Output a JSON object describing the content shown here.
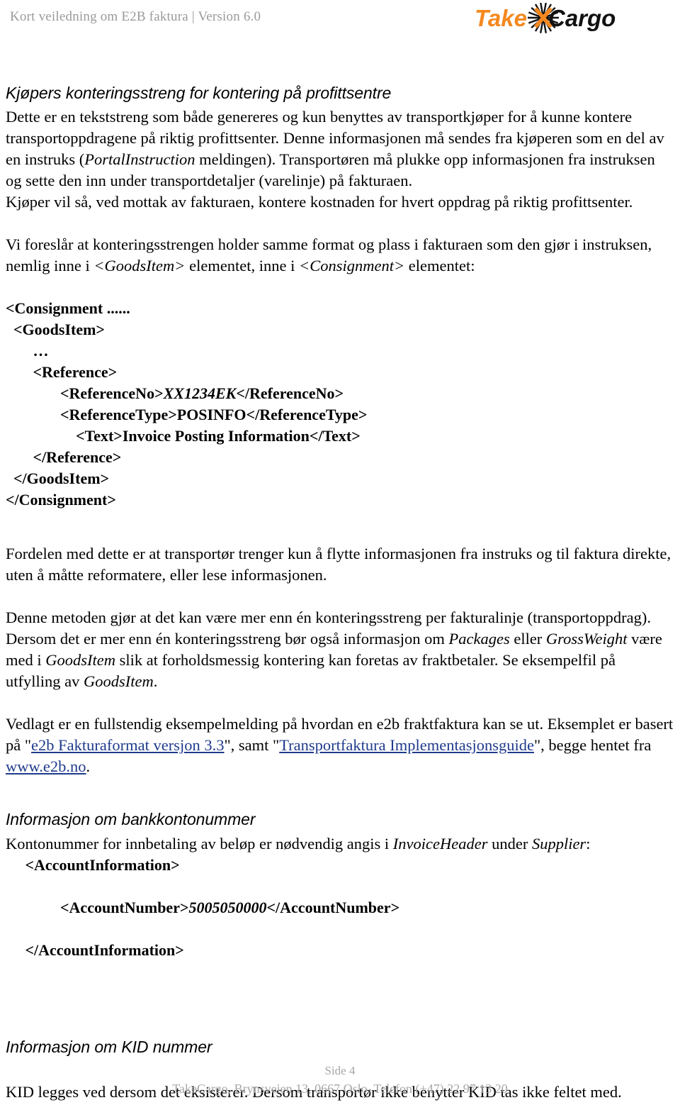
{
  "header": {
    "title": "Kort veiledning om E2B faktura | Version 6.0",
    "logo": {
      "name": "takecargo-logo",
      "text_orange": "Take",
      "text_black": "Cargo",
      "orange": "#F5881F",
      "black": "#111111"
    }
  },
  "main": {
    "section1": {
      "heading": "Kjøpers konteringsstreng for kontering på profittsentre",
      "para1_a": "Dette er en tekststreng som både genereres og kun benyttes av transportkjøper for å kunne kontere transportoppdragene på riktig profittsenter.  Denne informasjonen må sendes fra kjøperen som en del av en instruks (",
      "para1_em1": "PortalInstruction",
      "para1_b": " meldingen).  Transportøren må plukke opp informasjonen fra instruksen og sette den inn under transportdetaljer (varelinje) på fakturaen.",
      "para2": "Kjøper vil så, ved mottak av fakturaen, kontere kostnaden for hvert oppdrag på riktig profittsenter.",
      "para3_a": "Vi foreslår at konteringsstrengen holder samme format og plass i fakturaen som den gjør i instruksen, nemlig inne i ",
      "para3_em1": "<GoodsItem>",
      "para3_b": " elementet, inne i ",
      "para3_em2": "<Consignment>",
      "para3_c": " elementet:"
    },
    "code_consignment": {
      "line1": "<Consignment ......",
      "line2": "  <GoodsItem>",
      "line3": "       …",
      "line4": "       <Reference>",
      "line5_pre": "              <ReferenceNo>",
      "line5_val": "XX1234EK",
      "line5_post": "</ReferenceNo>",
      "line6": "              <ReferenceType>POSINFO</ReferenceType>",
      "line7": "                  <Text>Invoice Posting Information</Text>",
      "line8": "       </Reference>",
      "line9": "  </GoodsItem>",
      "line10": "</Consignment>"
    },
    "section2": {
      "para1": "Fordelen med dette er at transportør trenger kun å flytte informasjonen fra instruks og til faktura direkte, uten å måtte reformatere, eller lese informasjonen.",
      "para2": "Denne metoden gjør at det kan være mer enn én konteringsstreng per fakturalinje (transportoppdrag).",
      "para3_a": "Dersom det er mer enn én konteringsstreng bør også informasjon om ",
      "para3_em1": "Packages",
      "para3_b": " eller ",
      "para3_em2": "GrossWeight",
      "para3_c": " være med i ",
      "para3_em3": "GoodsItem",
      "para3_d": " slik at forholdsmessig kontering kan foretas av fraktbetaler.  Se eksempelfil på utfylling av ",
      "para3_em4": "GoodsItem",
      "para3_e": ".",
      "para4_a": "Vedlagt er en fullstendig eksempelmelding på hvordan en e2b fraktfaktura kan se ut.  Eksemplet er basert på \"",
      "para4_link1": "e2b Fakturaformat versjon 3.3",
      "para4_b": "\", samt \"",
      "para4_link2": "Transportfaktura Implementasjonsguide",
      "para4_c": "\", begge hentet fra ",
      "para4_link3": "www.e2b.no",
      "para4_d": "."
    },
    "section3": {
      "heading": "Informasjon om bankkontonummer",
      "para1_a": "Kontonummer for innbetaling av beløp er nødvendig angis i ",
      "para1_em1": "InvoiceHeader",
      "para1_b": " under ",
      "para1_em2": "Supplier",
      "para1_c": ":",
      "code": {
        "line1": "     <AccountInformation>",
        "line2": "",
        "line3_pre": "              <AccountNumber>",
        "line3_val": "5005050000",
        "line3_post": "</AccountNumber>",
        "line4": "",
        "line5": "     </AccountInformation>"
      }
    },
    "section4": {
      "heading": "Informasjon om KID nummer",
      "para1": "KID legges ved dersom det eksisterer.  Dersom transportør ikke benytter KID tas ikke feltet med."
    }
  },
  "footer": {
    "page_no": "Side 4",
    "address": "TakeCargo, Brynsveien 13, 0667 Oslo, Telefon (+47)  22 97 13 20"
  }
}
